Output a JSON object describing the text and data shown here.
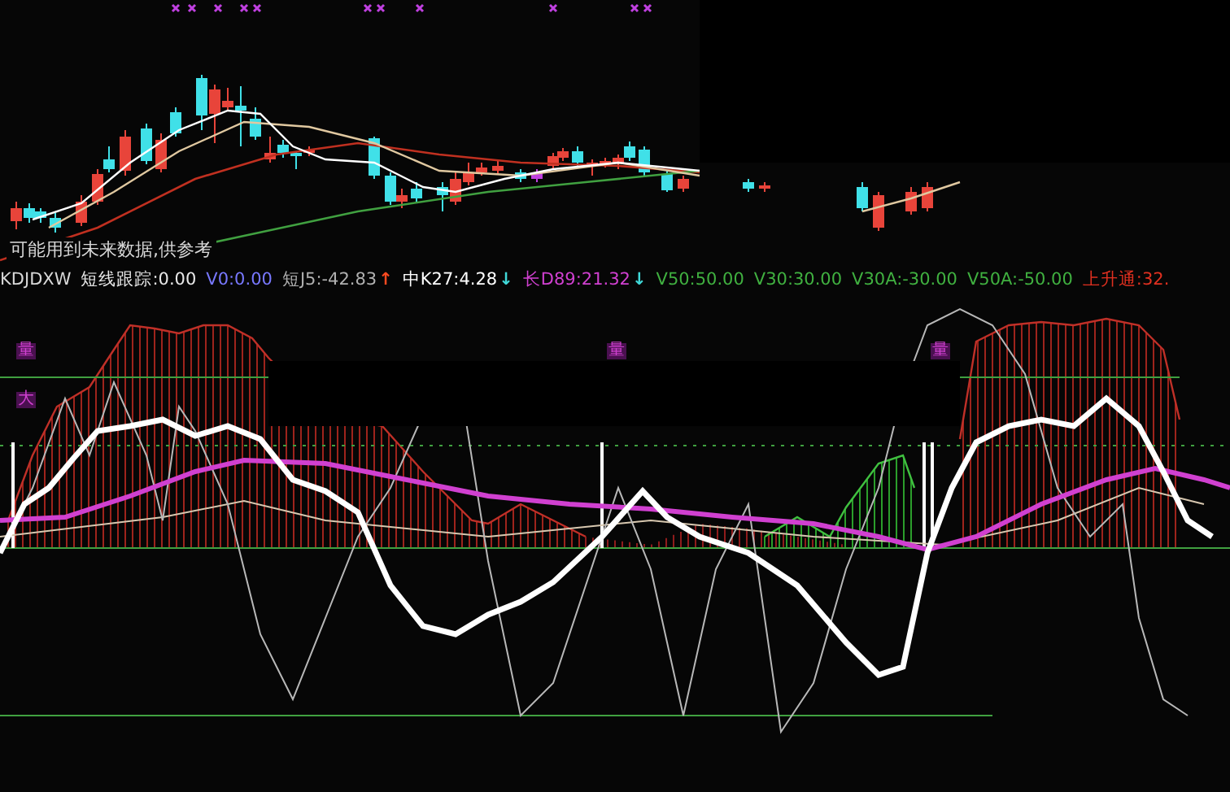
{
  "price_chart": {
    "note": "可能用到未来数据,供参考"
  },
  "indicator": {
    "header": [
      {
        "text": "KDJDXW",
        "color": "#d8d8d8"
      },
      {
        "text": "短线跟踪:0.00",
        "color": "#e8e8e8"
      },
      {
        "text": "V0:0.00",
        "color": "#7878ff"
      },
      {
        "text": "短J5:-42.83",
        "color": "#b0b0b0",
        "arrow": {
          "glyph": "↑",
          "color": "#ff4a20"
        }
      },
      {
        "text": "中K27:4.28",
        "color": "#ffffff",
        "arrow": {
          "glyph": "↓",
          "color": "#40d8d8"
        }
      },
      {
        "text": "长D89:21.32",
        "color": "#d040d0",
        "arrow": {
          "glyph": "↓",
          "color": "#40d8d8"
        }
      },
      {
        "text": "V50:50.00",
        "color": "#40b040"
      },
      {
        "text": "V30:30.00",
        "color": "#40b040"
      },
      {
        "text": "V30A:-30.00",
        "color": "#40b040"
      },
      {
        "text": "V50A:-50.00",
        "color": "#40b040"
      },
      {
        "text": "上升通:32.",
        "color": "#e03020"
      }
    ],
    "markers": [
      {
        "text": "量"
      },
      {
        "text": "大"
      },
      {
        "text": "量"
      },
      {
        "text": "量"
      }
    ]
  }
}
